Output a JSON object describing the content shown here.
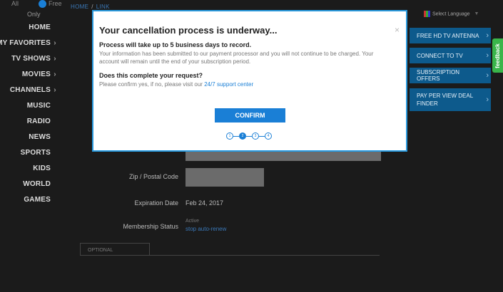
{
  "filter": {
    "all_label": "All",
    "free_label": "Free",
    "only_label": "Only"
  },
  "breadcrumb": {
    "home": "HOME",
    "separator": "/",
    "current": "LINK"
  },
  "nav": [
    {
      "label": "HOME",
      "chevron": false
    },
    {
      "label": "MY FAVORITES",
      "chevron": true
    },
    {
      "label": "TV SHOWS",
      "chevron": true
    },
    {
      "label": "MOVIES",
      "chevron": true
    },
    {
      "label": "CHANNELS",
      "chevron": true
    },
    {
      "label": "MUSIC",
      "chevron": false
    },
    {
      "label": "RADIO",
      "chevron": false
    },
    {
      "label": "NEWS",
      "chevron": false
    },
    {
      "label": "SPORTS",
      "chevron": false
    },
    {
      "label": "KIDS",
      "chevron": false
    },
    {
      "label": "WORLD",
      "chevron": false
    },
    {
      "label": "GAMES",
      "chevron": false
    }
  ],
  "chevron_glyph": "›",
  "language": {
    "label": "Select Language",
    "caret": "▼"
  },
  "side_buttons": [
    {
      "label": "FREE HD TV ANTENNA"
    },
    {
      "label": "CONNECT TO TV"
    },
    {
      "label": "SUBSCRIPTION OFFERS"
    },
    {
      "label": "PAY PER VIEW DEAL FINDER"
    }
  ],
  "feedback_label": "feedback",
  "form": {
    "zip_label": "Zip / Postal Code",
    "expiration_label": "Expiration Date",
    "expiration_value": "Feb 24, 2017",
    "membership_label": "Membership Status",
    "membership_value": "Active",
    "auto_renew_link": "stop auto-renew",
    "optional_tab": "OPTIONAL"
  },
  "modal": {
    "title": "Your cancellation process is underway...",
    "close_glyph": "×",
    "heading1": "Process will take up to 5 business days to record.",
    "body1": "Your information has been submitted to our payment processor and you will not continue to be charged. Your account will remain until the end of your subscription period.",
    "heading2": "Does this complete your request?",
    "body2_prefix": "Please confirm yes, if no, please visit our ",
    "body2_link": "24/7 support center",
    "confirm_label": "CONFIRM",
    "steps": [
      "1",
      "2",
      "3",
      "4"
    ],
    "active_step": 2
  },
  "colors": {
    "accent": "#1a7fd6",
    "modal_border": "#2a9be0",
    "side_button": "#0d5a8c",
    "feedback": "#39b54a"
  }
}
